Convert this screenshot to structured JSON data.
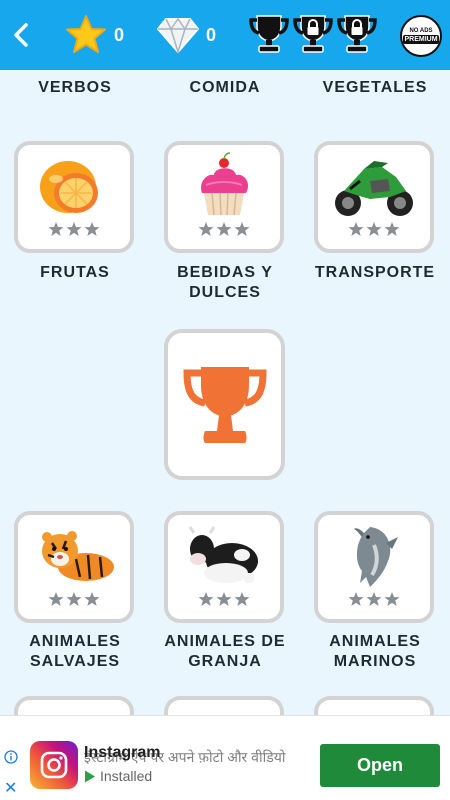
{
  "header": {
    "back_icon": "chevron-left-icon",
    "stars_count": "0",
    "gems_count": "0",
    "trophies": [
      "trophy-icon",
      "locked-trophy-icon",
      "locked-trophy-icon"
    ],
    "premium": {
      "line1": "NO ADS",
      "line2": "PREMIUM"
    }
  },
  "categories_row0": [
    "VERBOS",
    "COMIDA",
    "VEGETALES"
  ],
  "categories": [
    {
      "label": "FRUTAS",
      "icon": "fruit-picture",
      "stars_earned": 0,
      "stars_total": 3
    },
    {
      "label": "BEBIDAS Y DULCES",
      "icon": "cupcake-picture",
      "stars_earned": 0,
      "stars_total": 3
    },
    {
      "label": "TRANSPORTE",
      "icon": "motorcycle-picture",
      "stars_earned": 0,
      "stars_total": 3
    },
    {
      "label": "ANIMALES SALVAJES",
      "icon": "tiger-picture",
      "stars_earned": 0,
      "stars_total": 3
    },
    {
      "label": "ANIMALES DE GRANJA",
      "icon": "cow-picture",
      "stars_earned": 0,
      "stars_total": 3
    },
    {
      "label": "ANIMALES MARINOS",
      "icon": "dolphin-picture",
      "stars_earned": 0,
      "stars_total": 3
    }
  ],
  "reward_card": {
    "icon": "trophy-icon"
  },
  "ad": {
    "app_name": "Instagram",
    "description": "इंस्टाग्राम ऐप पर अपने फ़ोटो और वीडियो",
    "status": "Installed",
    "button": "Open"
  },
  "colors": {
    "topbar": "#17a7ec",
    "background": "#eaf6fd",
    "card_border": "#d3d3d3",
    "trophy_orange": "#f07234",
    "star_yellow": "#fcc81a",
    "open_button": "#1e8a3a"
  }
}
